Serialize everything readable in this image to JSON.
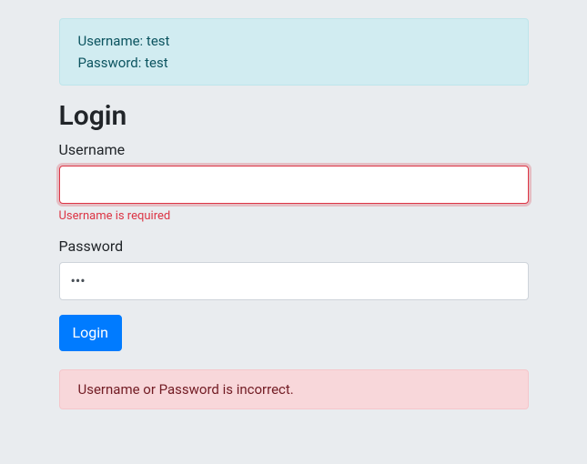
{
  "info_banner": {
    "line1": "Username: test",
    "line2": "Password: test"
  },
  "heading": "Login",
  "form": {
    "username": {
      "label": "Username",
      "value": "",
      "error": "Username is required"
    },
    "password": {
      "label": "Password",
      "value": "•••"
    },
    "submit_label": "Login"
  },
  "error_banner": "Username or Password is incorrect."
}
